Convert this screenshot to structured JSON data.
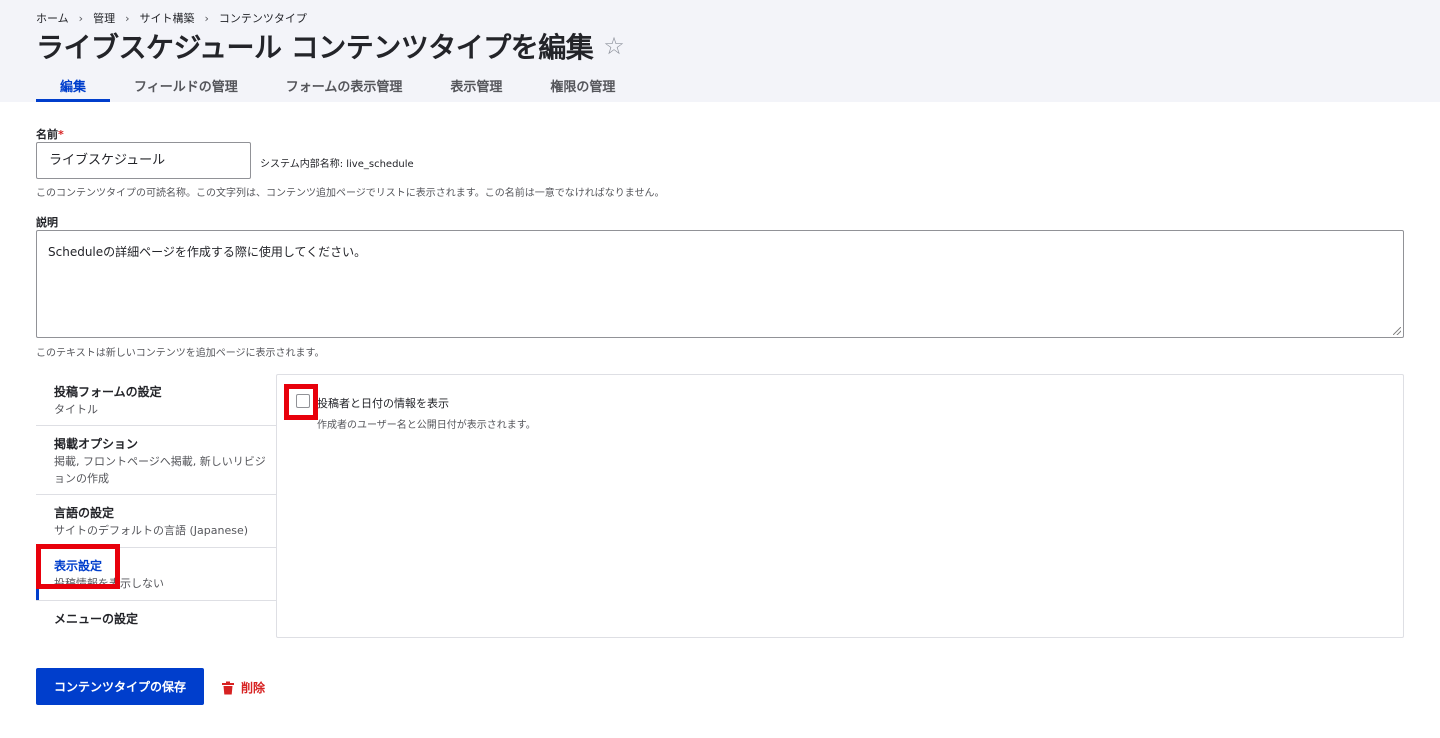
{
  "breadcrumb": [
    "ホーム",
    "管理",
    "サイト構築",
    "コンテンツタイプ"
  ],
  "breadcrumb_separator": "›",
  "page_title": "ライブスケジュール コンテンツタイプを編集",
  "star_icon": "☆",
  "tabs": [
    {
      "label": "編集",
      "active": true
    },
    {
      "label": "フィールドの管理",
      "active": false
    },
    {
      "label": "フォームの表示管理",
      "active": false
    },
    {
      "label": "表示管理",
      "active": false
    },
    {
      "label": "権限の管理",
      "active": false
    }
  ],
  "form": {
    "name_label": "名前",
    "required_marker": "*",
    "name_value": "ライブスケジュール",
    "machine_name": "システム内部名称: live_schedule",
    "name_help": "このコンテンツタイプの可読名称。この文字列は、コンテンツ追加ページでリストに表示されます。この名前は一意でなければなりません。",
    "description_label": "説明",
    "description_value": "Scheduleの詳細ページを作成する際に使用してください。",
    "description_help": "このテキストは新しいコンテンツを追加ページに表示されます。"
  },
  "vertical_tabs": [
    {
      "title": "投稿フォームの設定",
      "summary": "タイトル",
      "active": false
    },
    {
      "title": "掲載オプション",
      "summary": "掲載, フロントページへ掲載, 新しいリビジョンの作成",
      "active": false
    },
    {
      "title": "言語の設定",
      "summary": "サイトのデフォルトの言語 (Japanese)",
      "active": false
    },
    {
      "title": "表示設定",
      "summary": "投稿情報を表示しない",
      "active": true
    },
    {
      "title": "メニューの設定",
      "summary": "",
      "active": false
    }
  ],
  "display_pane": {
    "checkbox_label": "投稿者と日付の情報を表示",
    "checkbox_checked": false,
    "checkbox_desc": "作成者のユーザー名と公開日付が表示されます。"
  },
  "actions": {
    "save_label": "コンテンツタイプの保存",
    "delete_label": "削除"
  },
  "colors": {
    "accent": "#003ecc",
    "danger": "#d72222",
    "highlight": "#e8000b"
  }
}
